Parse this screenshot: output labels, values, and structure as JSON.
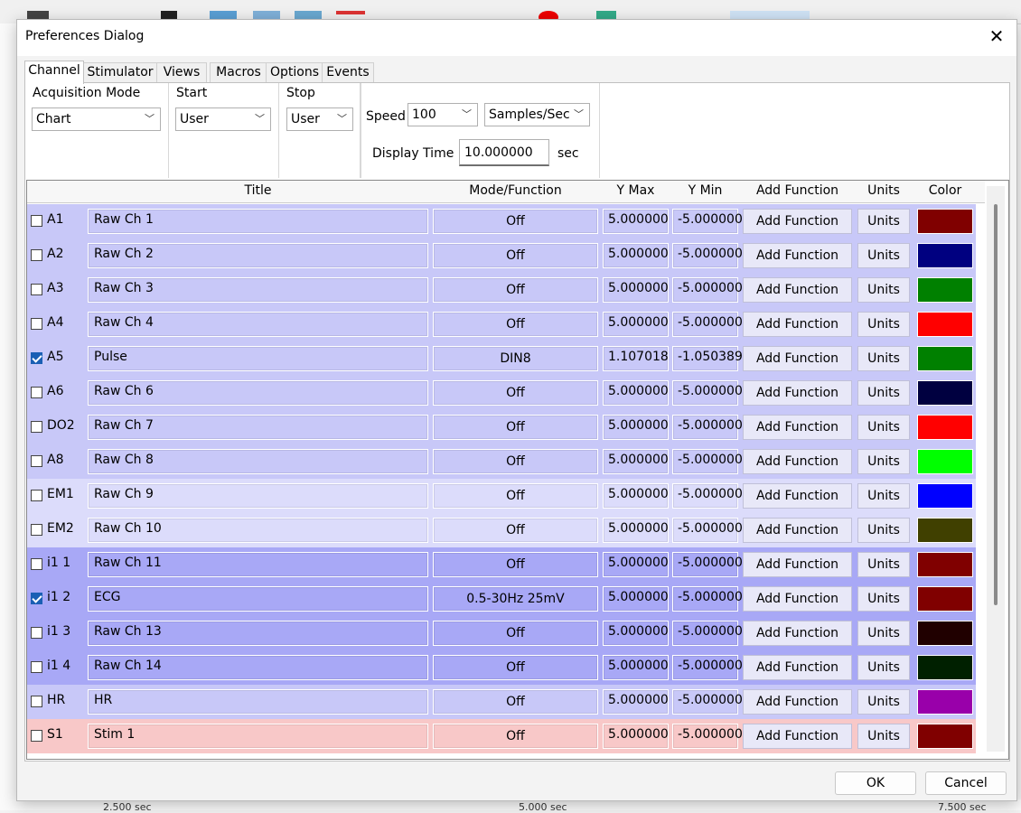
{
  "dialog": {
    "title": "Preferences Dialog",
    "ok_label": "OK",
    "cancel_label": "Cancel"
  },
  "tabs": [
    {
      "label": "Channel",
      "active": true
    },
    {
      "label": "Stimulator"
    },
    {
      "label": "Views"
    },
    {
      "label": "Macros"
    },
    {
      "label": "Options"
    },
    {
      "label": "Events"
    }
  ],
  "settings": {
    "acquisition_mode": {
      "label": "Acquisition Mode",
      "value": "Chart"
    },
    "start": {
      "label": "Start",
      "value": "User"
    },
    "stop": {
      "label": "Stop",
      "value": "User"
    },
    "speed": {
      "label": "Speed",
      "value": "100",
      "unit_value": "Samples/Sec"
    },
    "display_time": {
      "label": "Display Time",
      "value": "10.000000",
      "unit": "sec"
    }
  },
  "grid": {
    "headers": {
      "title": "Title",
      "mode": "Mode/Function",
      "ymax": "Y Max",
      "ymin": "Y Min",
      "add_function": "Add Function",
      "units": "Units",
      "color": "Color"
    },
    "rows": [
      {
        "channel": "A1",
        "checked": false,
        "title": "Raw Ch 1",
        "mode": "Off",
        "ymax": "5.000000",
        "ymin": "-5.000000",
        "add_function": "Add Function",
        "units": "Units",
        "color": "#800000",
        "bg": "#c8c8f8"
      },
      {
        "channel": "A2",
        "checked": false,
        "title": "Raw Ch 2",
        "mode": "Off",
        "ymax": "5.000000",
        "ymin": "-5.000000",
        "add_function": "Add Function",
        "units": "Units",
        "color": "#000080",
        "bg": "#c8c8f8"
      },
      {
        "channel": "A3",
        "checked": false,
        "title": "Raw Ch 3",
        "mode": "Off",
        "ymax": "5.000000",
        "ymin": "-5.000000",
        "add_function": "Add Function",
        "units": "Units",
        "color": "#008000",
        "bg": "#c8c8f8"
      },
      {
        "channel": "A4",
        "checked": false,
        "title": "Raw Ch 4",
        "mode": "Off",
        "ymax": "5.000000",
        "ymin": "-5.000000",
        "add_function": "Add Function",
        "units": "Units",
        "color": "#ff0000",
        "bg": "#c8c8f8"
      },
      {
        "channel": "A5",
        "checked": true,
        "title": "Pulse",
        "mode": "DIN8",
        "ymax": "1.107018",
        "ymin": "-1.050389",
        "add_function": "Add Function",
        "units": "Units",
        "color": "#008000",
        "bg": "#c8c8f8"
      },
      {
        "channel": "A6",
        "checked": false,
        "title": "Raw Ch 6",
        "mode": "Off",
        "ymax": "5.000000",
        "ymin": "-5.000000",
        "add_function": "Add Function",
        "units": "Units",
        "color": "#000040",
        "bg": "#c8c8f8"
      },
      {
        "channel": "DO2",
        "checked": false,
        "title": "Raw Ch 7",
        "mode": "Off",
        "ymax": "5.000000",
        "ymin": "-5.000000",
        "add_function": "Add Function",
        "units": "Units",
        "color": "#ff0000",
        "bg": "#c8c8f8"
      },
      {
        "channel": "A8",
        "checked": false,
        "title": "Raw Ch 8",
        "mode": "Off",
        "ymax": "5.000000",
        "ymin": "-5.000000",
        "add_function": "Add Function",
        "units": "Units",
        "color": "#00ff00",
        "bg": "#c8c8f8"
      },
      {
        "channel": "EM1",
        "checked": false,
        "title": "Raw Ch 9",
        "mode": "Off",
        "ymax": "5.000000",
        "ymin": "-5.000000",
        "add_function": "Add Function",
        "units": "Units",
        "color": "#0000ff",
        "bg": "#dcdcfb"
      },
      {
        "channel": "EM2",
        "checked": false,
        "title": "Raw Ch 10",
        "mode": "Off",
        "ymax": "5.000000",
        "ymin": "-5.000000",
        "add_function": "Add Function",
        "units": "Units",
        "color": "#404000",
        "bg": "#dcdcfb"
      },
      {
        "channel": "i1 1",
        "checked": false,
        "title": "Raw Ch 11",
        "mode": "Off",
        "ymax": "5.000000",
        "ymin": "-5.000000",
        "add_function": "Add Function",
        "units": "Units",
        "color": "#800000",
        "bg": "#a8a8f6"
      },
      {
        "channel": "i1 2",
        "checked": true,
        "title": "ECG",
        "mode": "0.5-30Hz 25mV",
        "ymax": "5.000000",
        "ymin": "-5.000000",
        "add_function": "Add Function",
        "units": "Units",
        "color": "#800000",
        "bg": "#a8a8f6"
      },
      {
        "channel": "i1 3",
        "checked": false,
        "title": "Raw Ch 13",
        "mode": "Off",
        "ymax": "5.000000",
        "ymin": "-5.000000",
        "add_function": "Add Function",
        "units": "Units",
        "color": "#200000",
        "bg": "#a8a8f6"
      },
      {
        "channel": "i1 4",
        "checked": false,
        "title": "Raw Ch 14",
        "mode": "Off",
        "ymax": "5.000000",
        "ymin": "-5.000000",
        "add_function": "Add Function",
        "units": "Units",
        "color": "#002000",
        "bg": "#a8a8f6"
      },
      {
        "channel": "HR",
        "checked": false,
        "title": "HR",
        "mode": "Off",
        "ymax": "5.000000",
        "ymin": "-5.000000",
        "add_function": "Add Function",
        "units": "Units",
        "color": "#9900aa",
        "bg": "#c8c8f8"
      },
      {
        "channel": "S1",
        "checked": false,
        "title": "Stim 1",
        "mode": "Off",
        "ymax": "5.000000",
        "ymin": "-5.000000",
        "add_function": "Add Function",
        "units": "Units",
        "color": "#800000",
        "bg": "#f8c8c8"
      }
    ]
  },
  "background": {
    "time_labels": [
      "2.500 sec",
      "5.000 sec",
      "7.500 sec"
    ]
  }
}
